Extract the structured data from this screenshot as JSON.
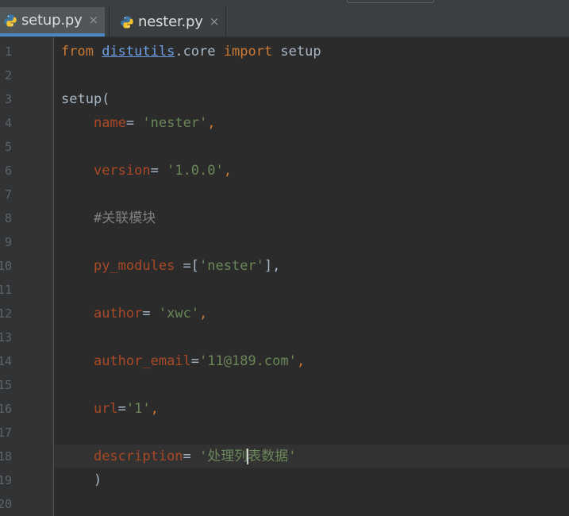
{
  "tabs": [
    {
      "label": "setup.py",
      "close": "×",
      "active": true
    },
    {
      "label": "nester.py",
      "close": "×",
      "active": false
    }
  ],
  "line_numbers": [
    "1",
    "2",
    "3",
    "4",
    "5",
    "6",
    "7",
    "8",
    "9",
    "10",
    "11",
    "12",
    "13",
    "14",
    "15",
    "16",
    "17",
    "18",
    "19",
    "20"
  ],
  "code": {
    "l1": {
      "from": "from",
      "sp1": " ",
      "module": "distutils",
      "rest": ".core",
      "sp2": " ",
      "import": "import",
      "tail": " setup"
    },
    "l3": {
      "text": "setup("
    },
    "l4": {
      "indent": "    ",
      "key": "name",
      "eq": "= ",
      "value": "'nester'",
      "end": ","
    },
    "l6": {
      "indent": "    ",
      "key": "version",
      "eq": "= ",
      "value": "'1.0.0'",
      "end": ","
    },
    "l8": {
      "indent": "    ",
      "comment": "#关联模块"
    },
    "l10": {
      "indent": "    ",
      "key": "py_modules",
      "eq": " =[",
      "value": "'nester'",
      "end": "],"
    },
    "l12": {
      "indent": "    ",
      "key": "author",
      "eq": "= ",
      "value": "'xwc'",
      "end": ","
    },
    "l14": {
      "indent": "    ",
      "key": "author_email",
      "eq": "=",
      "value": "'11@189.com'",
      "end": ","
    },
    "l16": {
      "indent": "    ",
      "key": "url",
      "eq": "=",
      "value": "'1'",
      "end": ","
    },
    "l18": {
      "indent": "    ",
      "key": "description",
      "eq": "= ",
      "value_before_caret": "'处理列",
      "value_after_caret": "表数据'"
    },
    "l19": {
      "indent": "    ",
      "text": ")"
    }
  },
  "colors": {
    "background": "#2b2b2b",
    "gutter": "#313335",
    "keyword": "#cc7832",
    "parameter": "#aa4926",
    "string": "#6a8759",
    "comment": "#808080",
    "default_text": "#a9b7c6",
    "active_tab_underline": "#4a88c7"
  },
  "icons": {
    "tab_file": "python-file-icon"
  }
}
